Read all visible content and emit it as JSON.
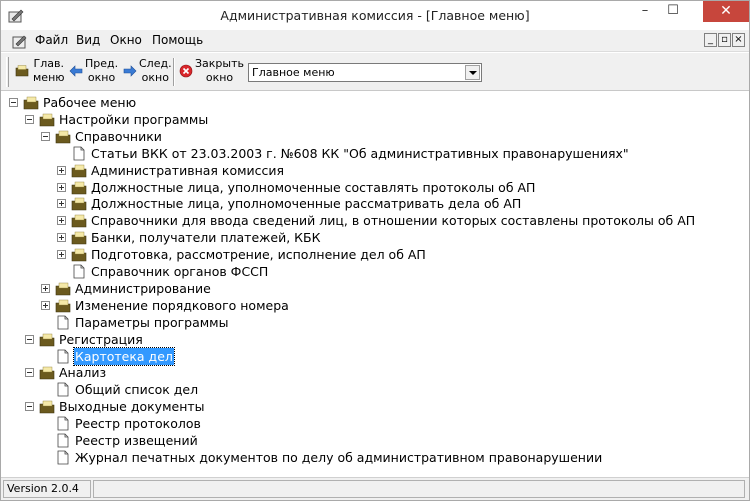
{
  "window": {
    "title": "Административная комиссия - [Главное меню]",
    "minimize": "–",
    "maximize": "☐",
    "close": "✕"
  },
  "menubar": {
    "items": [
      "Файл",
      "Вид",
      "Окно",
      "Помощь"
    ],
    "mdi": {
      "min": "_",
      "restore": "▫",
      "close": "×"
    }
  },
  "toolbar": {
    "home": {
      "line1": "Глав.",
      "line2": "меню"
    },
    "prev": {
      "line1": "Пред.",
      "line2": "окно"
    },
    "next": {
      "line1": "След.",
      "line2": "окно"
    },
    "close": {
      "line1": "Закрыть",
      "line2": "окно"
    },
    "combo_value": "Главное меню"
  },
  "tree": {
    "nodes": [
      "Рабочее меню",
      "Настройки программы",
      "Справочники",
      "Статьи ВКК от 23.03.2003 г. №608 КК \"Об административных правонарушениях\"",
      "Административная комиссия",
      "Должностные лица, уполномоченные составлять протоколы об АП",
      "Должностные лица, уполномоченные рассматривать дела об АП",
      "Справочники для ввода сведений лиц, в отношении которых составлены протоколы об АП",
      "Банки, получатели платежей, КБК",
      "Подготовка, рассмотрение, исполнение дел об АП",
      "Справочник органов ФССП",
      "Администрирование",
      "Изменение порядкового номера",
      "Параметры программы",
      "Регистрация",
      "Картотека дел",
      "Анализ",
      "Общий список дел",
      "Выходные документы",
      "Реестр протоколов",
      "Реестр извещений",
      "Журнал печатных документов по делу об административном правонарушении"
    ]
  },
  "statusbar": {
    "version": "Version 2.0.4"
  },
  "colors": {
    "selection": "#3399ff",
    "folder": "#6b5a1e",
    "close_btn": "#c7463c"
  }
}
